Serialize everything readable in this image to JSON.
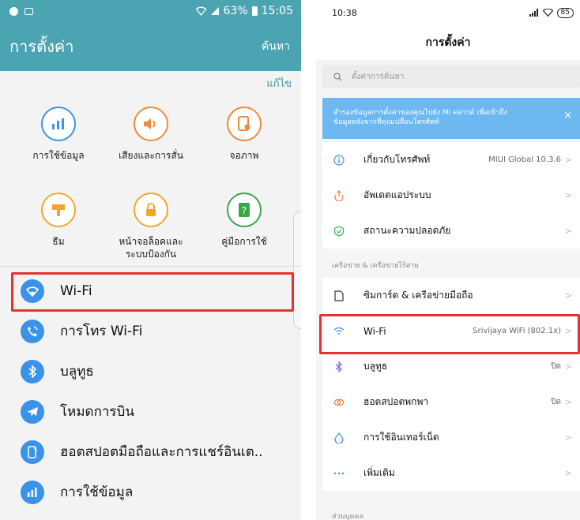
{
  "left": {
    "status": {
      "icons": [
        "messenger-icon",
        "gallery-icon"
      ],
      "signal": "็",
      "battery": "63%",
      "time": "15:05"
    },
    "appbar": {
      "title": "การตั้งค่า",
      "search": "ค้นหา"
    },
    "edit": "แก้ไข",
    "quick": [
      {
        "label": "การใช้ข้อมูล",
        "icon": "data-usage-icon",
        "color": "#3a93e8"
      },
      {
        "label": "เสียงและการสั่น",
        "icon": "sound-icon",
        "color": "#f08a3c"
      },
      {
        "label": "จอภาพ",
        "icon": "display-icon",
        "color": "#f08a3c"
      },
      {
        "label": "ธีม",
        "icon": "theme-icon",
        "color": "#f3a62c"
      },
      {
        "label": "หน้าจอล็อคและ\nระบบป้องกัน",
        "icon": "lock-icon",
        "color": "#f3a62c"
      },
      {
        "label": "คู่มือการใช้",
        "icon": "manual-icon",
        "color": "#37a84a"
      }
    ],
    "items": [
      {
        "label": "Wi-Fi",
        "icon": "wifi-icon"
      },
      {
        "label": "การโทร Wi-Fi",
        "icon": "wifi-calling-icon"
      },
      {
        "label": "บลูทูธ",
        "icon": "bluetooth-icon"
      },
      {
        "label": "โหมดการบิน",
        "icon": "airplane-icon"
      },
      {
        "label": "ฮอตสปอตมือถือและการแชร์อินเต..",
        "icon": "hotspot-icon"
      },
      {
        "label": "การใช้ข้อมูล",
        "icon": "data-usage-icon"
      }
    ]
  },
  "right": {
    "status": {
      "time": "10:38",
      "battery": "85"
    },
    "title": "การตั้งค่า",
    "search_placeholder": "ตั้งค่าการค้นหา",
    "banner": {
      "line1": "สำรองข้อมูลการตั้งค่าของคุณไปยัง Mi คลาวด์ เพื่อเข้าถึง",
      "line2": "ข้อมูลหลังจากที่คุณเปลี่ยนโทรศัพท์",
      "close": "×"
    },
    "group1": [
      {
        "label": "เกี่ยวกับโทรศัพท์",
        "value": "MIUI Global 10.3.6",
        "icon": "info-icon"
      },
      {
        "label": "อัพเดตแอประบบ",
        "value": "",
        "icon": "update-icon"
      },
      {
        "label": "สถานะความปลอดภัย",
        "value": "",
        "icon": "security-icon"
      }
    ],
    "section2": "เครือข่าย & เครือข่ายไร้สาย",
    "group2": [
      {
        "label": "ซิมการ์ด & เครือข่ายมือถือ",
        "value": "",
        "icon": "sim-icon"
      },
      {
        "label": "Wi-Fi",
        "value": "Srivijaya WiFi (802.1x)",
        "icon": "wifi-icon"
      },
      {
        "label": "บลูทูธ",
        "value": "ปิด",
        "icon": "bluetooth-icon"
      },
      {
        "label": "ฮอตสปอตพกพา",
        "value": "ปิด",
        "icon": "hotspot-icon"
      },
      {
        "label": "การใช้อินเทอร์เน็ต",
        "value": "",
        "icon": "data-icon"
      },
      {
        "label": "เพิ่มเติม",
        "value": "",
        "icon": "more-icon"
      }
    ],
    "section3": "ส่วนบุคคล"
  }
}
